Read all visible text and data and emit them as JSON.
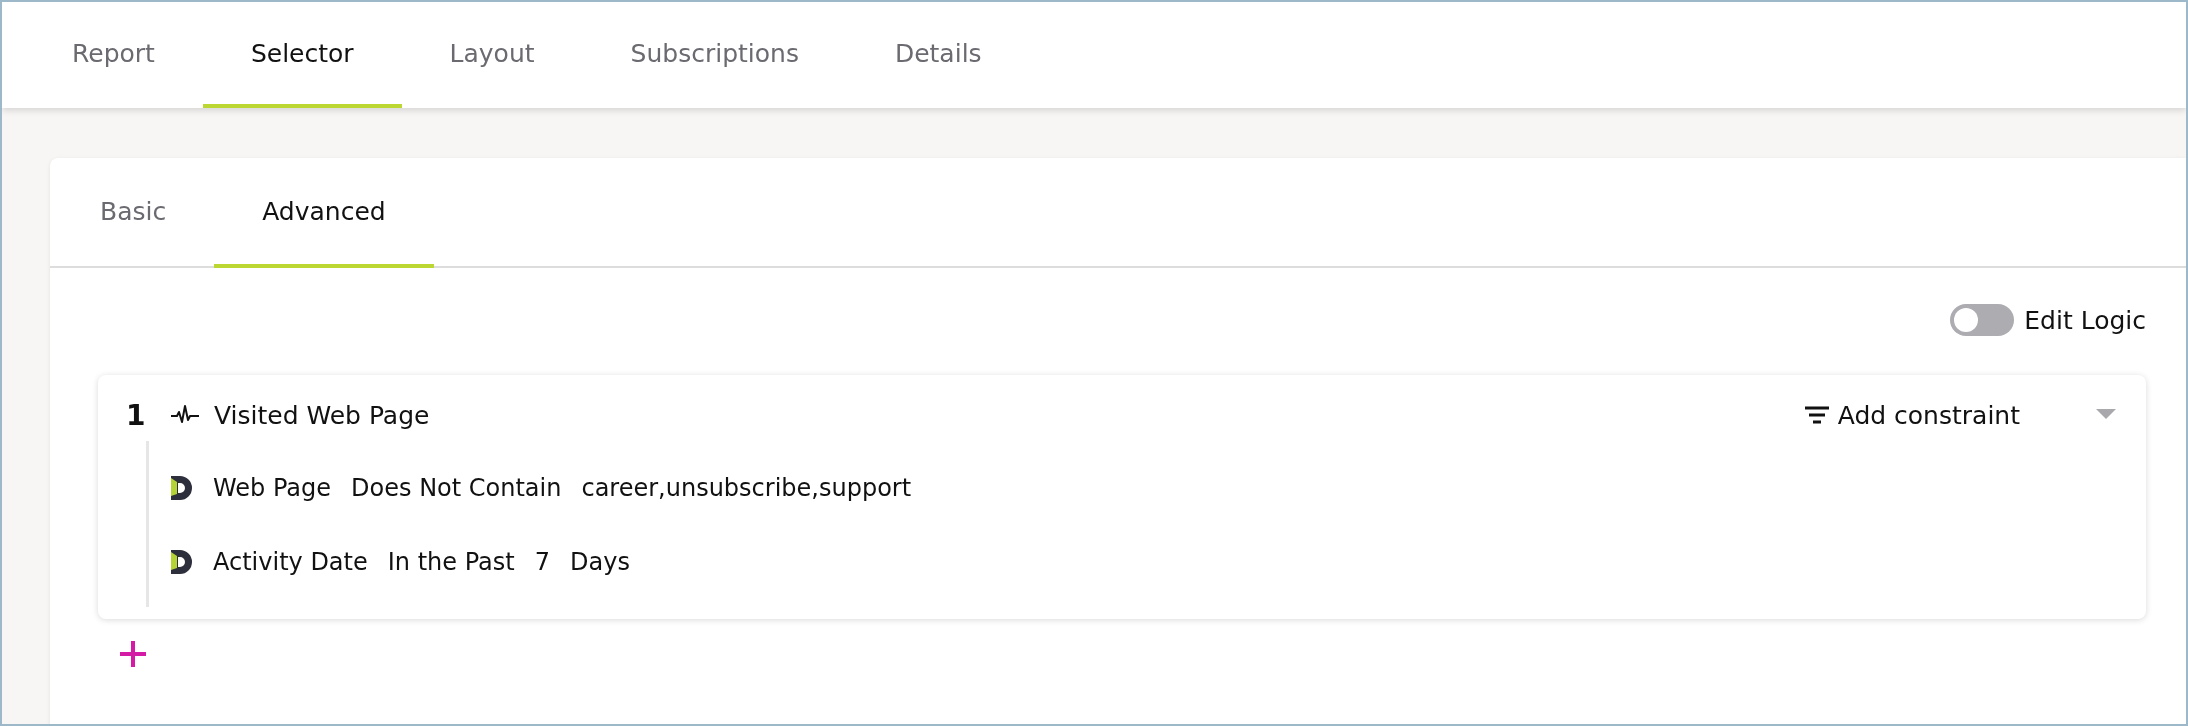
{
  "tabs": [
    {
      "label": "Report",
      "selected": false
    },
    {
      "label": "Selector",
      "selected": true
    },
    {
      "label": "Layout",
      "selected": false
    },
    {
      "label": "Subscriptions",
      "selected": false
    },
    {
      "label": "Details",
      "selected": false
    }
  ],
  "subtabs": [
    {
      "label": "Basic",
      "selected": false
    },
    {
      "label": "Advanced",
      "selected": true
    }
  ],
  "edit_logic": {
    "label": "Edit Logic",
    "on": false
  },
  "rules": [
    {
      "number": "1",
      "title": "Visited Web Page",
      "add_constraint": "Add constraint",
      "conditions": [
        {
          "parts": [
            "Web Page",
            "Does Not Contain",
            "career,unsubscribe,support"
          ]
        },
        {
          "parts": [
            "Activity Date",
            "In the Past",
            "7",
            "Days"
          ]
        }
      ]
    }
  ]
}
